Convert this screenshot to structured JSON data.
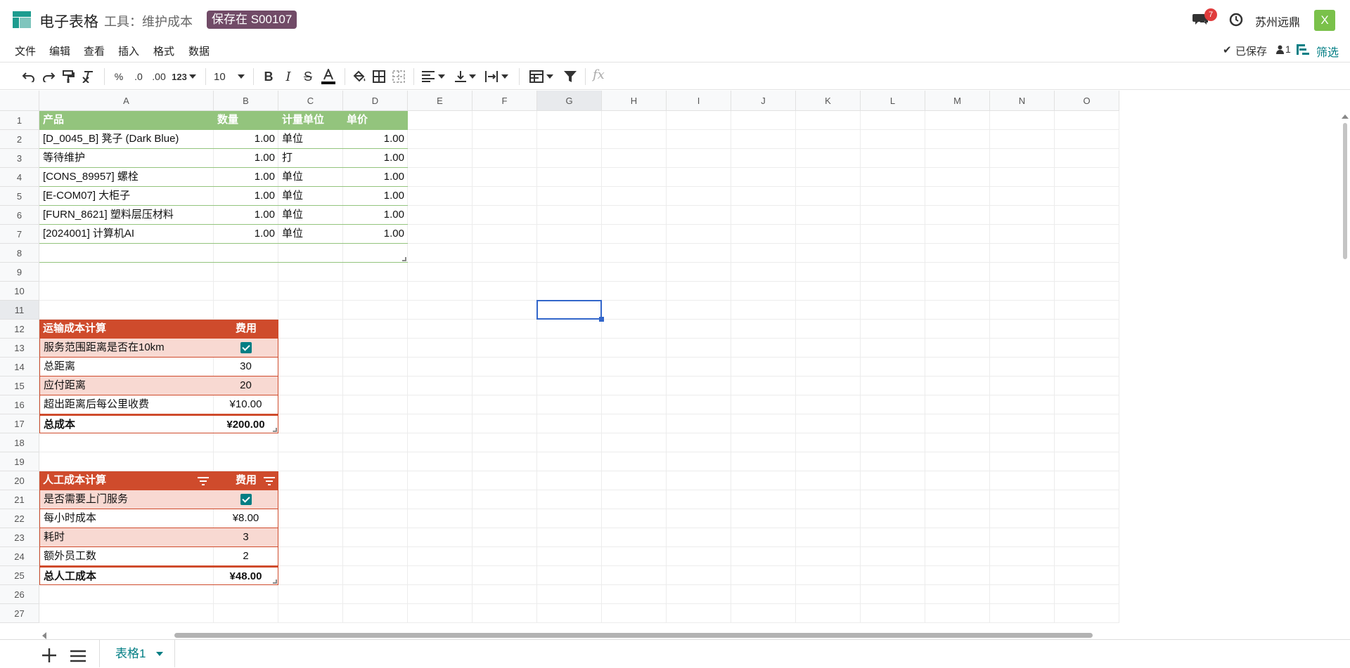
{
  "header": {
    "app_title": "电子表格",
    "breadcrumb": "工具：维护成本",
    "save_badge": "保存在 S00107",
    "notification_count": "7",
    "company": "苏州远鼎",
    "avatar_initial": "X"
  },
  "menu": {
    "items": [
      "文件",
      "编辑",
      "查看",
      "插入",
      "格式",
      "数据"
    ],
    "saved_status": "已保存",
    "user_count": "1",
    "filter_label": "筛选"
  },
  "toolbar": {
    "percent": "%",
    "dec_decrease": ".0",
    "dec_increase": ".00",
    "more_formats": "123",
    "font_size": "10",
    "formula_placeholder": "fx"
  },
  "grid": {
    "columns": [
      "A",
      "B",
      "C",
      "D",
      "E",
      "F",
      "G",
      "H",
      "I",
      "J",
      "K",
      "L",
      "M",
      "N",
      "O"
    ],
    "selected_column": "G",
    "selected_row": "11",
    "rows": [
      "1",
      "2",
      "3",
      "4",
      "5",
      "6",
      "7",
      "8",
      "9",
      "10",
      "11",
      "12",
      "13",
      "14",
      "15",
      "16",
      "17",
      "18",
      "19",
      "20",
      "21",
      "22",
      "23",
      "24",
      "25",
      "26",
      "27"
    ],
    "product_table": {
      "headers": [
        "产品",
        "数量",
        "计量单位",
        "单价"
      ],
      "rows": [
        [
          "[D_0045_B] 凳子 (Dark Blue)",
          "1.00",
          "单位",
          "1.00"
        ],
        [
          "等待维护",
          "1.00",
          "打",
          "1.00"
        ],
        [
          "[CONS_89957] 螺栓",
          "1.00",
          "单位",
          "1.00"
        ],
        [
          "[E-COM07] 大柜子",
          "1.00",
          "单位",
          "1.00"
        ],
        [
          "[FURN_8621] 塑料层压材料",
          "1.00",
          "单位",
          "1.00"
        ],
        [
          "[2024001] 计算机AI",
          "1.00",
          "单位",
          "1.00"
        ]
      ]
    },
    "transport_table": {
      "headers": [
        "运输成本计算",
        "费用"
      ],
      "rows": [
        [
          "服务范围距离是否在10km",
          "checkbox"
        ],
        [
          "总距离",
          "30"
        ],
        [
          "应付距离",
          "20"
        ],
        [
          "超出距离后每公里收费",
          "¥10.00"
        ]
      ],
      "total_label": "总成本",
      "total_value": "¥200.00"
    },
    "labor_table": {
      "headers": [
        "人工成本计算",
        "费用"
      ],
      "rows": [
        [
          "是否需要上门服务",
          "checkbox"
        ],
        [
          "每小时成本",
          "¥8.00"
        ],
        [
          "耗时",
          "3"
        ],
        [
          "额外员工数",
          "2"
        ]
      ],
      "total_label": "总人工成本",
      "total_value": "¥48.00"
    }
  },
  "sheets": {
    "active": "表格1"
  }
}
